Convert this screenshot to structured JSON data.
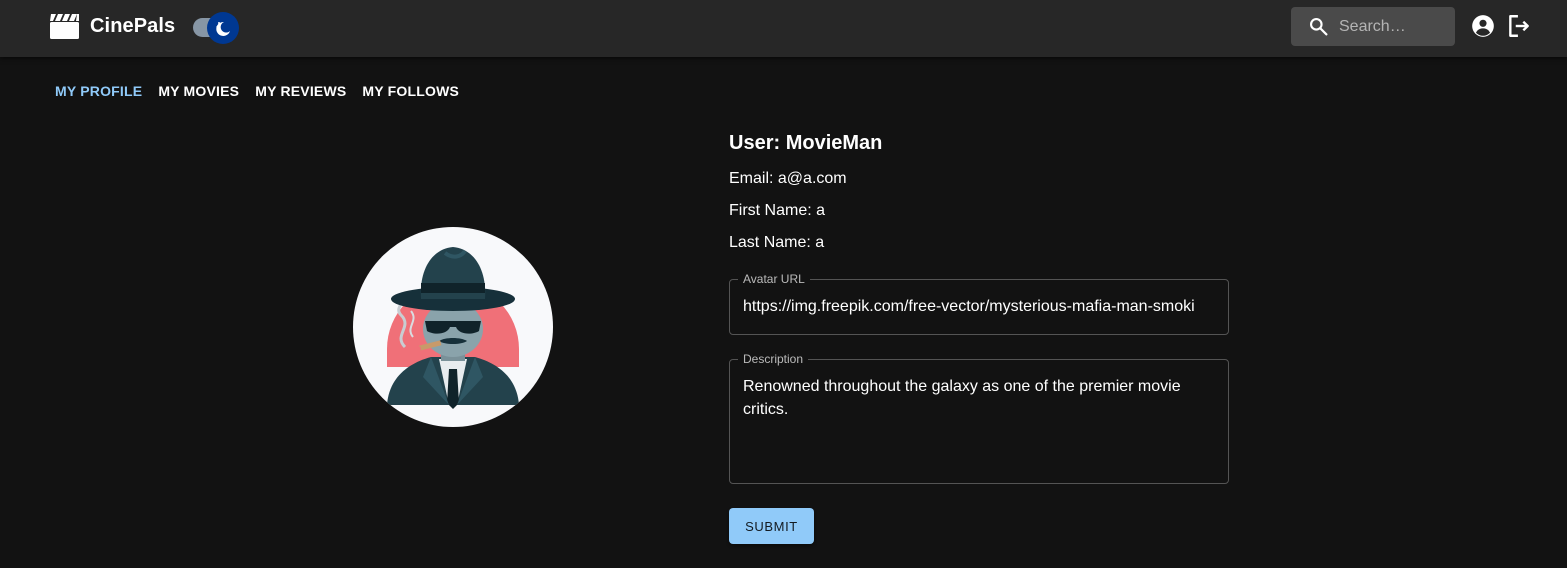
{
  "app": {
    "name": "CinePals",
    "brand_icon": "movie-clapperboard-icon"
  },
  "header": {
    "theme_toggle": {
      "mode": "dark",
      "icon": "moon-stars-icon"
    },
    "search": {
      "placeholder": "Search…",
      "icon": "search-icon",
      "value": ""
    },
    "account_icon": "account-circle-icon",
    "logout_icon": "logout-icon"
  },
  "tabs": [
    {
      "label": "MY PROFILE",
      "active": true
    },
    {
      "label": "MY MOVIES",
      "active": false
    },
    {
      "label": "MY REVIEWS",
      "active": false
    },
    {
      "label": "MY FOLLOWS",
      "active": false
    }
  ],
  "profile": {
    "username_text": "User: MovieMan",
    "email_text": "Email: a@a.com",
    "first_name_text": "First Name: a",
    "last_name_text": "Last Name: a",
    "avatar_image": "mysterious-mafia-man-smoking-illustration"
  },
  "form": {
    "avatar_url": {
      "label": "Avatar URL",
      "value": "https://img.freepik.com/free-vector/mysterious-mafia-man-smoki"
    },
    "description": {
      "label": "Description",
      "value": "Renowned throughout the galaxy as one of the premier movie critics."
    },
    "submit_label": "SUBMIT"
  },
  "colors": {
    "background": "#121212",
    "appbar": "#272727",
    "accent": "#90caf9",
    "toggle_thumb": "#003892",
    "search_bg": "#4a4a4a"
  }
}
